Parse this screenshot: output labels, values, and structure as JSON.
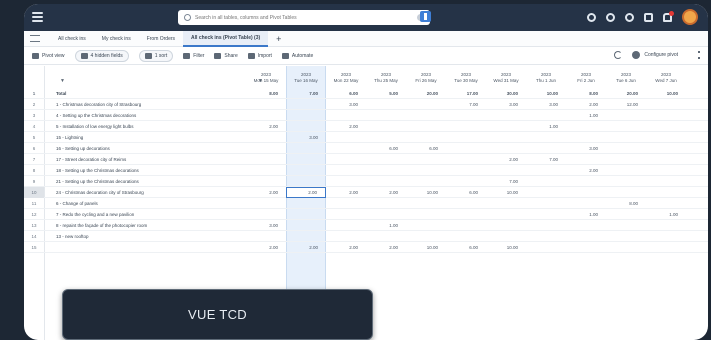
{
  "topbar": {
    "search_placeholder": "Search in all tables, columns and Pivot Tables"
  },
  "tabs": [
    {
      "label": "All check ins"
    },
    {
      "label": "My check ins"
    },
    {
      "label": "From Orders"
    },
    {
      "label": "All check ins (Pivot Table) (3)"
    }
  ],
  "toolbar": {
    "pivot_view": "Pivot view",
    "hidden_fields": "4 hidden fields",
    "sort": "1 sort",
    "filter": "Filter",
    "share": "Share",
    "import": "Import",
    "automate": "Automate",
    "configure": "Configure pivot"
  },
  "columns": [
    {
      "year": "2023",
      "day": "Mon 15 May"
    },
    {
      "year": "2023",
      "day": "Tue 16 May"
    },
    {
      "year": "2023",
      "day": "Mon 22 May"
    },
    {
      "year": "2023",
      "day": "Thu 25 May"
    },
    {
      "year": "2023",
      "day": "Fri 26 May"
    },
    {
      "year": "2023",
      "day": "Tue 30 May"
    },
    {
      "year": "2023",
      "day": "Wed 31 May"
    },
    {
      "year": "2023",
      "day": "Thu 1 Jun"
    },
    {
      "year": "2023",
      "day": "Fri 2 Jun"
    },
    {
      "year": "2023",
      "day": "Tue 6 Jun"
    },
    {
      "year": "2023",
      "day": "Wed 7 Jun"
    }
  ],
  "rows": [
    {
      "num": "1",
      "label": "Total",
      "values": [
        "8.00",
        "7.00",
        "6.00",
        "5.00",
        "20.00",
        "17.00",
        "30.00",
        "10.00",
        "8.00",
        "20.00",
        "10.00"
      ]
    },
    {
      "num": "2",
      "label": "1 - Christmas decoration city of Strasbourg",
      "values": [
        "",
        "",
        "3.00",
        "",
        "",
        "7.00",
        "3.00",
        "3.00",
        "2.00",
        "12.00",
        ""
      ]
    },
    {
      "num": "3",
      "label": "4 - Setting up the Christmas decorations",
      "values": [
        "",
        "",
        "",
        "",
        "",
        "",
        "",
        "",
        "1.00",
        "",
        ""
      ]
    },
    {
      "num": "4",
      "label": "5 - Installation of low energy light bulbs",
      "values": [
        "2.00",
        "",
        "2.00",
        "",
        "",
        "",
        "",
        "1.00",
        "",
        "",
        ""
      ]
    },
    {
      "num": "5",
      "label": "15 - Lightning",
      "values": [
        "",
        "3.00",
        "",
        "",
        "",
        "",
        "",
        "",
        "",
        "",
        ""
      ]
    },
    {
      "num": "6",
      "label": "16 - Setting up decorations",
      "values": [
        "",
        "",
        "",
        "6.00",
        "6.00",
        "",
        "",
        "",
        "3.00",
        "",
        ""
      ]
    },
    {
      "num": "7",
      "label": "17 - Street decoration city of Reims",
      "values": [
        "",
        "",
        "",
        "",
        "",
        "",
        "2.00",
        "7.00",
        "",
        "",
        ""
      ]
    },
    {
      "num": "8",
      "label": "18 - Setting up the Christmas decorations",
      "values": [
        "",
        "",
        "",
        "",
        "",
        "",
        "",
        "",
        "2.00",
        "",
        ""
      ]
    },
    {
      "num": "9",
      "label": "21 - Setting up the Christmas decorations",
      "values": [
        "",
        "",
        "",
        "",
        "",
        "",
        "7.00",
        "",
        "",
        "",
        ""
      ]
    },
    {
      "num": "10",
      "label": "24 - Christmas decoration city of Strasbourg",
      "values": [
        "2.00",
        "2.00",
        "2.00",
        "2.00",
        "10.00",
        "6.00",
        "10.00",
        "",
        "",
        "",
        ""
      ]
    },
    {
      "num": "11",
      "label": "6 - Change of panels",
      "values": [
        "",
        "",
        "",
        "",
        "",
        "",
        "",
        "",
        "",
        "8.00",
        ""
      ]
    },
    {
      "num": "12",
      "label": "7 - Redo the cycling and a new pavilion",
      "values": [
        "",
        "",
        "",
        "",
        "",
        "",
        "",
        "",
        "1.00",
        "",
        "1.00"
      ]
    },
    {
      "num": "13",
      "label": "8 - repaint the façade of the photocopier room",
      "values": [
        "3.00",
        "",
        "",
        "1.00",
        "",
        "",
        "",
        "",
        "",
        "",
        ""
      ]
    },
    {
      "num": "14",
      "label": "13 - new rooftop",
      "values": [
        "",
        "",
        "",
        "",
        "",
        "",
        "",
        "",
        "",
        "",
        ""
      ]
    },
    {
      "num": "15",
      "label": "",
      "values": [
        "2.00",
        "2.00",
        "2.00",
        "2.00",
        "10.00",
        "6.00",
        "10.00",
        "",
        "",
        "",
        ""
      ]
    }
  ],
  "caption": {
    "text": "VUE TCD"
  }
}
